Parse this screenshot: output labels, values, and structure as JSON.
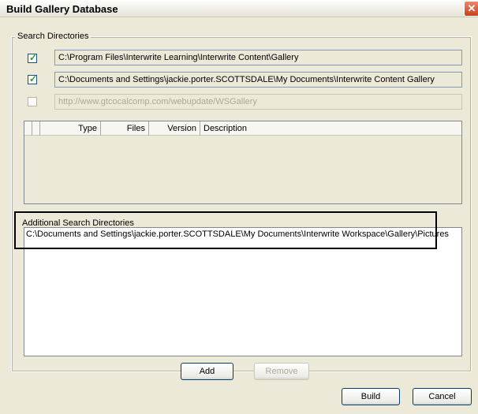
{
  "window": {
    "title": "Build Gallery Database",
    "close_symbol": "✕"
  },
  "search_directories": {
    "legend": "Search Directories",
    "items": [
      {
        "checked": true,
        "path": "C:\\Program Files\\Interwrite Learning\\Interwrite Content\\Gallery",
        "enabled": true
      },
      {
        "checked": true,
        "path": "C:\\Documents and Settings\\jackie.porter.SCOTTSDALE\\My Documents\\Interwrite Content Gallery",
        "enabled": true
      },
      {
        "checked": false,
        "path": "http://www.gtcocalcomp.com/webupdate/WSGallery",
        "enabled": false
      }
    ],
    "check_symbol": "✓",
    "columns": [
      "Type",
      "Files",
      "Version",
      "Description"
    ]
  },
  "additional_search": {
    "legend": "Additional Search Directories",
    "entry": "C:\\Documents and Settings\\jackie.porter.SCOTTSDALE\\My Documents\\Interwrite Workspace\\Gallery\\Pictures"
  },
  "buttons": {
    "add": "Add",
    "remove": "Remove",
    "build": "Build",
    "cancel": "Cancel"
  }
}
